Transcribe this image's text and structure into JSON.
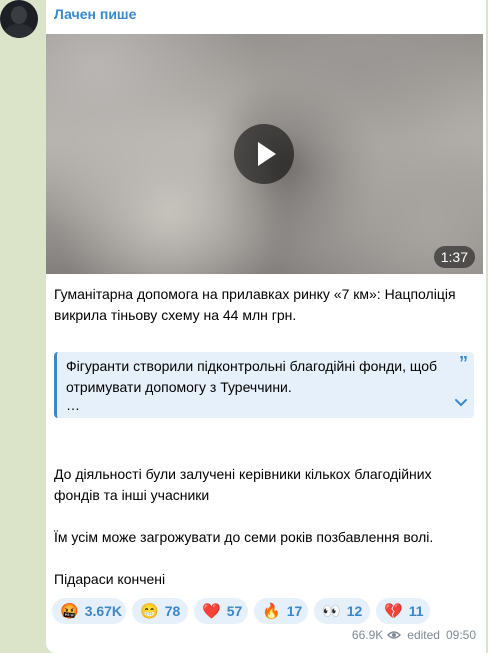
{
  "post": {
    "author": "Лачен пише",
    "video_duration": "1:37",
    "paragraph1": "Гуманітарна допомога на прилавках ринку «7 км»: Нацполіція викрила тіньову схему на 44 млн грн.",
    "quote_text": "Фігуранти створили підконтрольні благодійні фонди, щоб отримувати допомогу з Туреччини.",
    "quote_ellipsis": "…",
    "paragraph2": "До діяльності були залучені керівники кількох благодійних фондів та інші учасники",
    "paragraph3": "Їм усім може загрожувати до семи років позбавлення волі.",
    "paragraph4": "Підараси кончені"
  },
  "reactions": [
    {
      "emoji": "🤬",
      "count": "3.67K"
    },
    {
      "emoji": "😁",
      "count": "78"
    },
    {
      "emoji": "❤️",
      "count": "57"
    },
    {
      "emoji": "🔥",
      "count": "17"
    },
    {
      "emoji": "👀",
      "count": "12"
    },
    {
      "emoji": "💔",
      "count": "11"
    }
  ],
  "meta": {
    "views": "66.9K",
    "edited": "edited",
    "time": "09:50"
  },
  "colors": {
    "accent": "#3b88c8",
    "background": "#dbe3c9",
    "quote_bg": "#e6f0fa"
  }
}
